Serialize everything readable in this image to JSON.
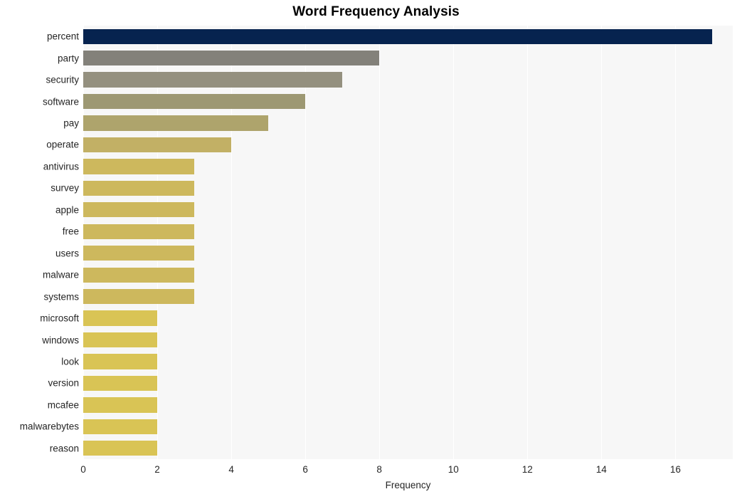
{
  "chart_data": {
    "type": "bar",
    "orientation": "horizontal",
    "title": "Word Frequency Analysis",
    "xlabel": "Frequency",
    "ylabel": "",
    "categories": [
      "percent",
      "party",
      "security",
      "software",
      "pay",
      "operate",
      "antivirus",
      "survey",
      "apple",
      "free",
      "users",
      "malware",
      "systems",
      "microsoft",
      "windows",
      "look",
      "version",
      "mcafee",
      "malwarebytes",
      "reason"
    ],
    "values": [
      17,
      8,
      7,
      6,
      5,
      4,
      3,
      3,
      3,
      3,
      3,
      3,
      3,
      2,
      2,
      2,
      2,
      2,
      2,
      2
    ],
    "bar_colors": [
      "#06234f",
      "#83817a",
      "#94907f",
      "#9d9873",
      "#aea46c",
      "#c2b065",
      "#cdb85d",
      "#cdb85d",
      "#cdb85d",
      "#cdb85d",
      "#cdb85d",
      "#cdb85d",
      "#cdb85d",
      "#d9c455",
      "#d9c455",
      "#d9c455",
      "#d9c455",
      "#d9c455",
      "#d9c455",
      "#d9c455"
    ],
    "xlim": [
      0,
      17.55
    ],
    "xticks": [
      0,
      2,
      4,
      6,
      8,
      10,
      12,
      14,
      16
    ],
    "xticklabels": [
      "0",
      "2",
      "4",
      "6",
      "8",
      "10",
      "12",
      "14",
      "16"
    ],
    "grid": true,
    "grid_color": "#ffffff",
    "plot_background": "#f7f7f7",
    "figure_background": "#ffffff",
    "legend": null,
    "tick_label_color": "#262626",
    "title_color": "#000000"
  }
}
